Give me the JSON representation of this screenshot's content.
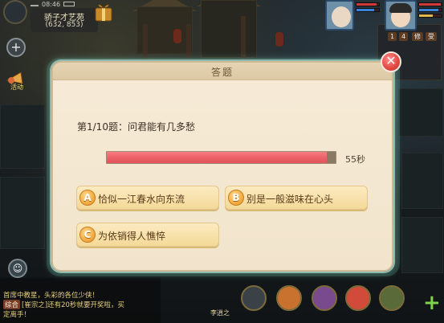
{
  "status_bar": {
    "time": "08:46"
  },
  "location": {
    "name": "骄子才艺苑",
    "coords": "(632, 853)"
  },
  "hud": {
    "event_label": "活动",
    "plus_label": "+",
    "chips": [
      "1",
      "4",
      "修",
      "受"
    ]
  },
  "quiz": {
    "title": "答题",
    "close_label": "✕",
    "question": "第1/10题：问君能有几多愁",
    "timer_text": "55秒",
    "timer_progress": 0.96,
    "answers": [
      {
        "letter": "A",
        "text": "恰似一江春水向东流"
      },
      {
        "letter": "B",
        "text": "别是一般滋味在心头"
      },
      {
        "letter": "C",
        "text": "为依销得人憔悴"
      }
    ]
  },
  "chat": {
    "lines": [
      {
        "tag": "",
        "text": ""
      },
      {
        "tag": "",
        "text": "首席中教星，头彩的各位少侠！"
      },
      {
        "tag": "综合",
        "text": "[崔宗之]还有20秒就要开奖啦，买"
      },
      {
        "tag": "",
        "text": "定离手！"
      }
    ]
  },
  "bottom_bar": {
    "labels": [
      "李逍之"
    ]
  },
  "colors": {
    "timer_fill": "#ec5f66",
    "accent_gold": "#f0a63a",
    "close_red": "#e2463f"
  }
}
